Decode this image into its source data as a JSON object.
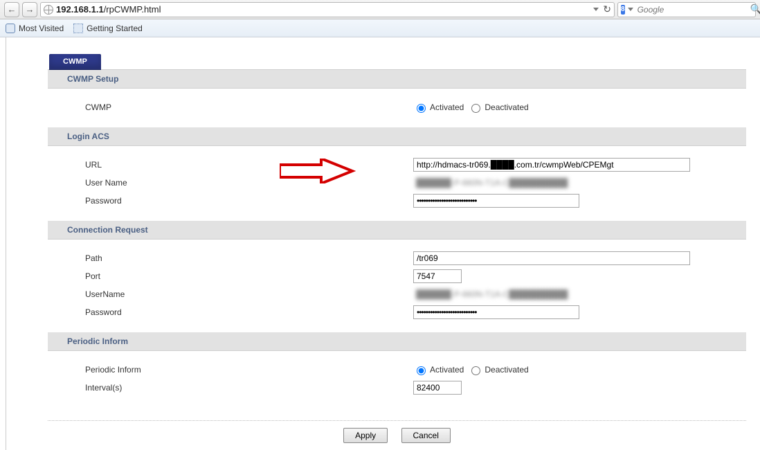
{
  "browser": {
    "url_host": "192.168.1.1",
    "url_path": "/rpCWMP.html",
    "search_placeholder": "Google",
    "bookmarks": {
      "most_visited": "Most Visited",
      "getting_started": "Getting Started"
    }
  },
  "tab_label": "CWMP",
  "sections": {
    "cwmp_setup": {
      "title": "CWMP Setup",
      "rows": {
        "cwmp_label": "CWMP",
        "activated_label": "Activated",
        "deactivated_label": "Deactivated"
      }
    },
    "login_acs": {
      "title": "Login ACS",
      "rows": {
        "url_label": "URL",
        "url_value": "http://hdmacs-tr069.████.com.tr/cwmpWeb/CPEMgt",
        "username_label": "User Name",
        "username_blurred": "██████-P-660N-T1A-C██████████",
        "password_label": "Password",
        "password_value": "•••••••••••••••••••••••••••"
      }
    },
    "connection_request": {
      "title": "Connection Request",
      "rows": {
        "path_label": "Path",
        "path_value": "/tr069",
        "port_label": "Port",
        "port_value": "7547",
        "username_label": "UserName",
        "username_blurred": "██████-P-660N-T1A-C██████████",
        "password_label": "Password",
        "password_value": "•••••••••••••••••••••••••••"
      }
    },
    "periodic_inform": {
      "title": "Periodic Inform",
      "rows": {
        "periodic_inform_label": "Periodic Inform",
        "activated_label": "Activated",
        "deactivated_label": "Deactivated",
        "interval_label": "Interval(s)",
        "interval_value": "82400"
      }
    }
  },
  "buttons": {
    "apply": "Apply",
    "cancel": "Cancel"
  }
}
